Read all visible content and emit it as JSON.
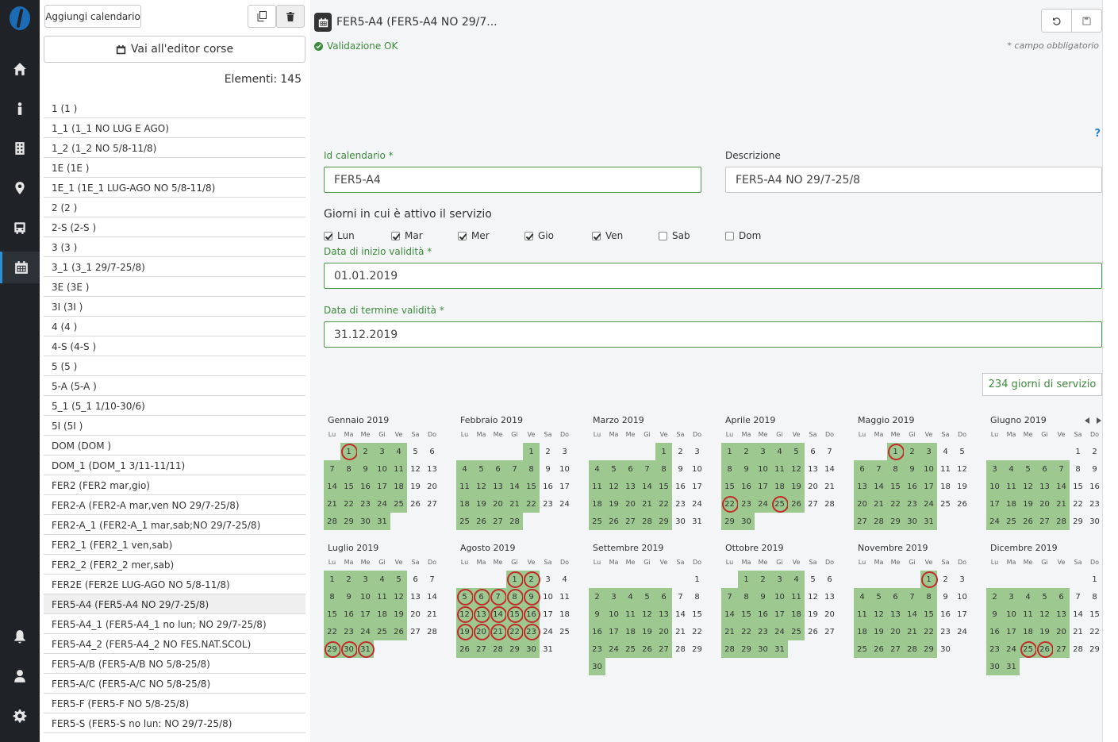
{
  "list_toolbar": {
    "add_label": "Aggiungi calendario",
    "editor_label": "Vai all'editor corse"
  },
  "list_summary": {
    "label": "Elementi:",
    "count": "145"
  },
  "calendars": [
    "1 (1 )",
    "1_1 (1_1 NO LUG E AGO)",
    "1_2 (1_2 NO 5/8-11/8)",
    "1E (1E )",
    "1E_1 (1E_1 LUG-AGO NO 5/8-11/8)",
    "2 (2 )",
    "2-S (2-S )",
    "3 (3 )",
    "3_1 (3_1 29/7-25/8)",
    "3E (3E )",
    "3I (3I )",
    "4 (4 )",
    "4-S (4-S )",
    "5 (5 )",
    "5-A (5-A )",
    "5_1 (5_1 1/10-30/6)",
    "5I (5I )",
    "DOM (DOM )",
    "DOM_1 (DOM_1 3/11-11/11)",
    "FER2 (FER2 mar,gio)",
    "FER2-A (FER2-A mar,ven NO 29/7-25/8)",
    "FER2-A_1 (FER2-A_1 mar,sab;NO 29/7-25/8)",
    "FER2_1 (FER2_1 ven,sab)",
    "FER2_2 (FER2_2 mer,sab)",
    "FER2E (FER2E LUG-AGO NO 5/8-11/8)",
    "FER5-A4 (FER5-A4 NO 29/7-25/8)",
    "FER5-A4_1 (FER5-A4_1 no lun; NO 29/7-25/8)",
    "FER5-A4_2 (FER5-A4_2 NO FES.NAT.SCOL)",
    "FER5-A/B (FER5-A/B NO 5/8-25/8)",
    "FER5-A/C (FER5-A/C NO 5/8-25/8)",
    "FER5-F (FER5-F NO 5/8-25/8)",
    "FER5-S (FER5-S no lun: NO 29/7-25/8)"
  ],
  "selected_index": 25,
  "detail": {
    "title": "FER5-A4 (FER5-A4 NO 29/7...",
    "validation": "Validazione OK",
    "required_note": "* campo obbligatorio",
    "help": "?",
    "id_label": "Id calendario *",
    "id_value": "FER5-A4",
    "desc_label": "Descrizione",
    "desc_value": "FER5-A4 NO 29/7-25/8",
    "days_label": "Giorni in cui è attivo il servizio",
    "days": [
      {
        "label": "Lun",
        "checked": true
      },
      {
        "label": "Mar",
        "checked": true
      },
      {
        "label": "Mer",
        "checked": true
      },
      {
        "label": "Gio",
        "checked": true
      },
      {
        "label": "Ven",
        "checked": true
      },
      {
        "label": "Sab",
        "checked": false
      },
      {
        "label": "Dom",
        "checked": false
      }
    ],
    "start_label": "Data di inizio validità *",
    "start_value": "01.01.2019",
    "end_label": "Data di termine validità *",
    "end_value": "31.12.2019",
    "service_days": "234 giorni di servizio"
  },
  "calendar": {
    "weekday_headers": [
      "Lu",
      "Ma",
      "Me",
      "Gi",
      "Ve",
      "Sa",
      "Do"
    ],
    "months": [
      {
        "name": "Gennaio 2019",
        "first_weekday": 1,
        "days": 31,
        "highlighted": [
          1
        ]
      },
      {
        "name": "Febbraio 2019",
        "first_weekday": 4,
        "days": 28,
        "highlighted": []
      },
      {
        "name": "Marzo 2019",
        "first_weekday": 4,
        "days": 31,
        "highlighted": []
      },
      {
        "name": "Aprile 2019",
        "first_weekday": 0,
        "days": 30,
        "highlighted": [
          22,
          25
        ]
      },
      {
        "name": "Maggio 2019",
        "first_weekday": 2,
        "days": 31,
        "highlighted": [
          1
        ]
      },
      {
        "name": "Giugno 2019",
        "first_weekday": 5,
        "days": 30,
        "highlighted": []
      },
      {
        "name": "Luglio 2019",
        "first_weekday": 0,
        "days": 31,
        "highlighted": [
          29,
          30,
          31
        ]
      },
      {
        "name": "Agosto 2019",
        "first_weekday": 3,
        "days": 31,
        "highlighted": [
          1,
          2,
          5,
          6,
          7,
          8,
          9,
          12,
          13,
          14,
          15,
          16,
          19,
          20,
          21,
          22,
          23
        ]
      },
      {
        "name": "Settembre 2019",
        "first_weekday": 6,
        "days": 30,
        "highlighted": []
      },
      {
        "name": "Ottobre 2019",
        "first_weekday": 1,
        "days": 31,
        "highlighted": []
      },
      {
        "name": "Novembre 2019",
        "first_weekday": 4,
        "days": 30,
        "highlighted": [
          1
        ]
      },
      {
        "name": "Dicembre 2019",
        "first_weekday": 6,
        "days": 31,
        "highlighted": [
          25,
          26
        ]
      }
    ]
  },
  "colors": {
    "active_day": "#9dc991",
    "holiday_ring": "#c22a2a",
    "ok_text": "#3c8a3c",
    "rail": "#1f2327"
  }
}
